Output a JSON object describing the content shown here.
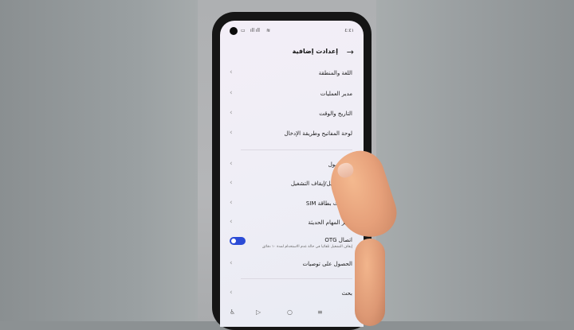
{
  "status_bar": {
    "time": "٤:٤١",
    "signal_text": "ıll ıll",
    "icons": [
      "camera-hole",
      "signal-icon",
      "wifi-icon",
      "battery-icon"
    ]
  },
  "header": {
    "title": "إعدادت إضافية",
    "back_icon": "arrow-right-icon"
  },
  "settings": [
    {
      "label": "اللغة والمنطقة"
    },
    {
      "label": "مدير العمليات"
    },
    {
      "label": "التاريخ والوقت"
    },
    {
      "label": "لوحة المفاتيح وطريقة الإدخال"
    },
    {
      "label": "ية الوصول"
    },
    {
      "label": "رة التشغيل/إيقاف التشغيل"
    },
    {
      "label": "تطبيقات بطاقة SIM"
    },
    {
      "label": "مدير المهام الحديثة"
    },
    {
      "label": "اتصال OTG",
      "sub": "إيقاف التشغيل تلقائيا في حالة عدم الاستخدام لمدة ١٠ دقائق",
      "toggle_on": true
    },
    {
      "label": "الحصول على توصيات"
    },
    {
      "label": "بحث"
    }
  ],
  "navbar": {
    "buttons": [
      "accessibility-icon",
      "back-triangle-icon",
      "home-circle-icon",
      "menu-lines-icon"
    ]
  },
  "colors": {
    "accent": "#2b4bd6",
    "screen_bg": "#f1eef6"
  }
}
